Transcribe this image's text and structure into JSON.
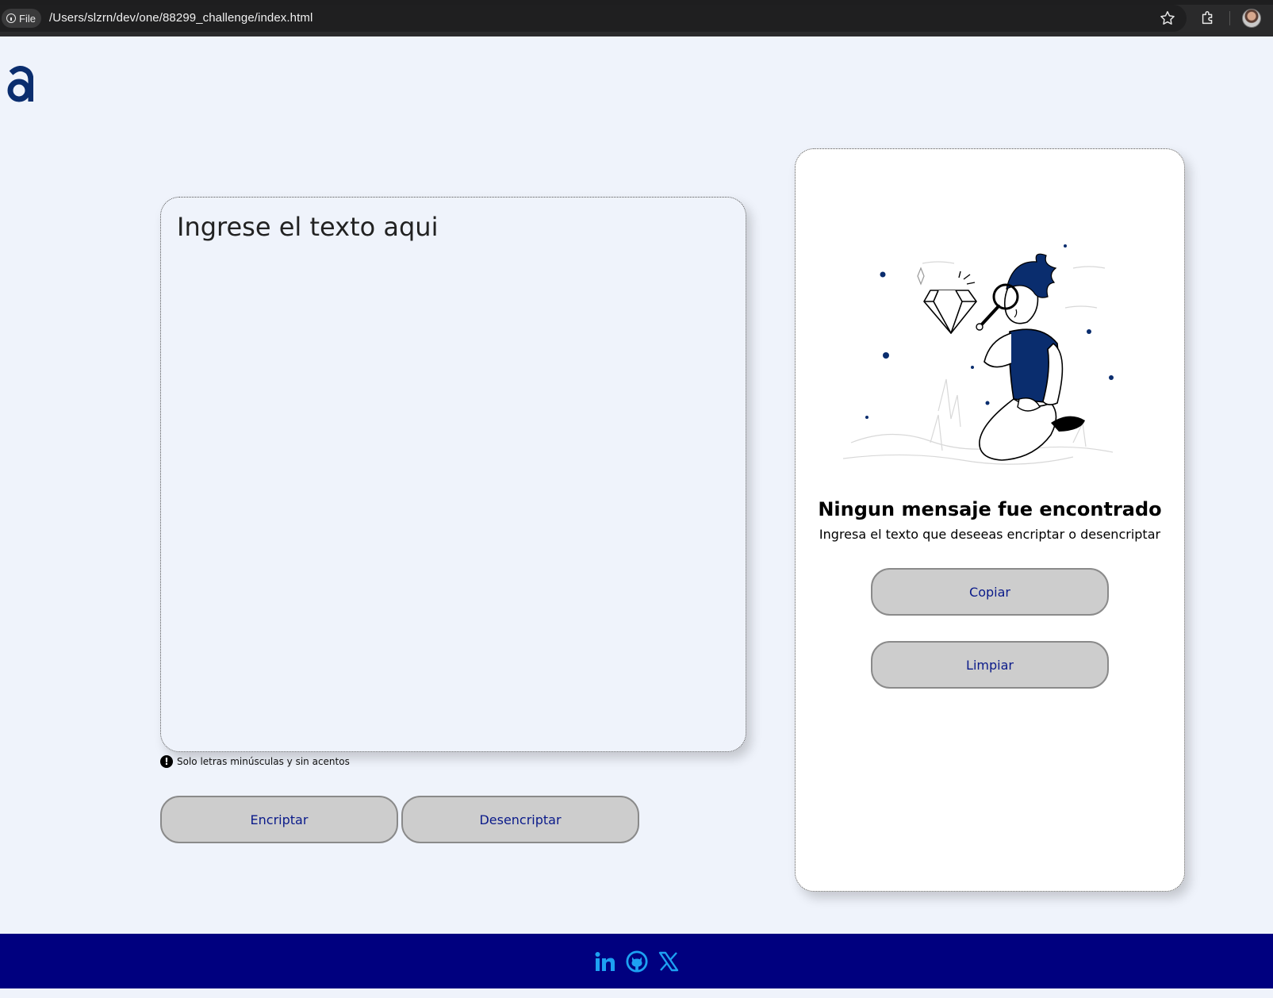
{
  "browser": {
    "chip_label": "File",
    "url": "/Users/slzrn/dev/one/88299_challenge/index.html"
  },
  "input": {
    "placeholder": "Ingrese el texto aqui",
    "hint": "Solo letras minúsculas y sin acentos",
    "hint_icon": "!"
  },
  "actions": {
    "encrypt_label": "Encriptar",
    "decrypt_label": "Desencriptar"
  },
  "output": {
    "title": "Ningun mensaje fue encontrado",
    "subtitle": "Ingresa el texto que deseeas encriptar o desencriptar",
    "copy_label": "Copiar",
    "clear_label": "Limpiar"
  },
  "footer": {
    "icons": [
      "linkedin-icon",
      "github-icon",
      "x-icon"
    ],
    "icon_color": "#1da1f2",
    "background": "#00007f"
  },
  "colors": {
    "page_bg": "#eff3fb",
    "button_bg": "#cdcdcd",
    "button_text": "#0a1a8a",
    "brand": "#0a2d6e"
  }
}
